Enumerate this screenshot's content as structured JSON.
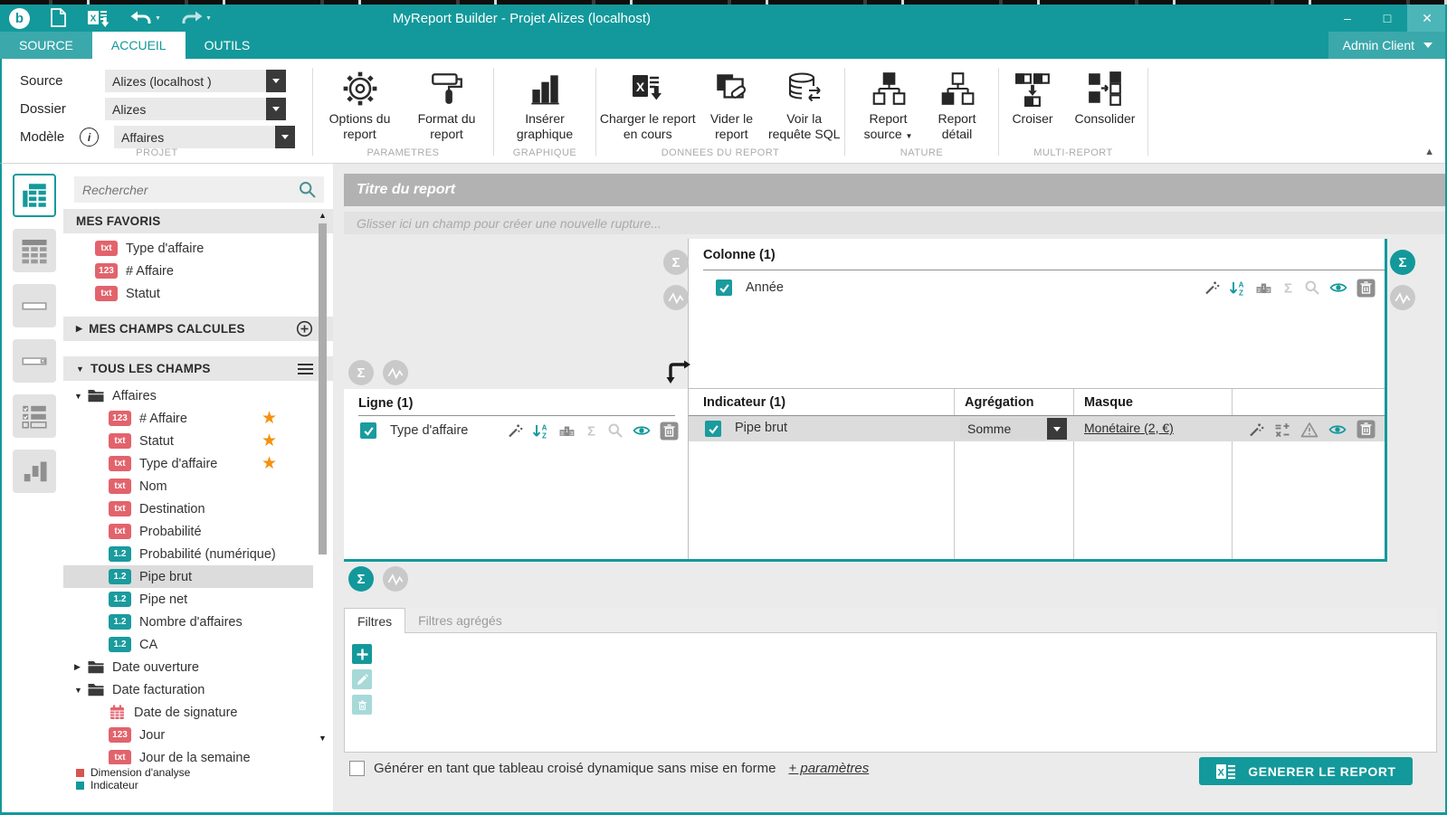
{
  "window": {
    "title": "MyReport Builder - Projet Alizes (localhost)",
    "controls": {
      "minimize": "–",
      "maximize": "□",
      "close": "✕"
    }
  },
  "tabs": [
    {
      "label": "SOURCE",
      "active": false
    },
    {
      "label": "ACCUEIL",
      "active": true
    },
    {
      "label": "OUTILS",
      "active": false
    }
  ],
  "user_menu": {
    "label": "Admin Client"
  },
  "ribbon": {
    "projet": {
      "caption": "PROJET",
      "rows": [
        {
          "label": "Source",
          "value": "Alizes (localhost )"
        },
        {
          "label": "Dossier",
          "value": "Alizes"
        },
        {
          "label": "Modèle",
          "value": "Affaires",
          "info": "i"
        }
      ]
    },
    "parametres": {
      "caption": "PARAMETRES",
      "options_label": "Options du report",
      "format_label": "Format du report"
    },
    "graphique": {
      "caption": "GRAPHIQUE",
      "inserer_label": "Insérer graphique"
    },
    "donnees": {
      "caption": "DONNEES DU REPORT",
      "charger_label": "Charger le report en cours",
      "vider_label": "Vider le report",
      "sql_label": "Voir la requête SQL"
    },
    "nature": {
      "caption": "NATURE",
      "source_label": "Report source",
      "detail_label": "Report détail"
    },
    "multireport": {
      "caption": "MULTI-REPORT",
      "croiser_label": "Croiser",
      "consolider_label": "Consolider"
    }
  },
  "fields_panel": {
    "search_placeholder": "Rechercher",
    "favorites_header": "MES FAVORIS",
    "favorites": [
      {
        "badge": "txt",
        "color": "red",
        "label": "Type d'affaire"
      },
      {
        "badge": "123",
        "color": "red",
        "label": "# Affaire"
      },
      {
        "badge": "txt",
        "color": "red",
        "label": "Statut"
      }
    ],
    "calculated_header": "MES CHAMPS CALCULES",
    "all_fields_header": "TOUS LES CHAMPS",
    "tree": [
      {
        "kind": "folder",
        "state": "open",
        "label": "Affaires"
      },
      {
        "kind": "field",
        "badge": "123",
        "color": "red",
        "label": "# Affaire",
        "starred": true
      },
      {
        "kind": "field",
        "badge": "txt",
        "color": "red",
        "label": "Statut",
        "starred": true
      },
      {
        "kind": "field",
        "badge": "txt",
        "color": "red",
        "label": "Type d'affaire",
        "starred": true
      },
      {
        "kind": "field",
        "badge": "txt",
        "color": "red",
        "label": "Nom"
      },
      {
        "kind": "field",
        "badge": "txt",
        "color": "red",
        "label": "Destination"
      },
      {
        "kind": "field",
        "badge": "txt",
        "color": "red",
        "label": "Probabilité"
      },
      {
        "kind": "field",
        "badge": "1.2",
        "color": "teal",
        "label": "Probabilité (numérique)"
      },
      {
        "kind": "field",
        "badge": "1.2",
        "color": "teal",
        "label": "Pipe brut",
        "selected": true
      },
      {
        "kind": "field",
        "badge": "1.2",
        "color": "teal",
        "label": "Pipe net"
      },
      {
        "kind": "field",
        "badge": "1.2",
        "color": "teal",
        "label": "Nombre d'affaires"
      },
      {
        "kind": "field",
        "badge": "1.2",
        "color": "teal",
        "label": "CA"
      },
      {
        "kind": "folder",
        "state": "closed",
        "label": "Date ouverture"
      },
      {
        "kind": "folder",
        "state": "open",
        "label": "Date facturation"
      },
      {
        "kind": "field",
        "badge": "cal",
        "color": "red",
        "label": "Date de signature"
      },
      {
        "kind": "field",
        "badge": "123",
        "color": "red",
        "label": "Jour"
      },
      {
        "kind": "field",
        "badge": "txt",
        "color": "red",
        "label": "Jour de la semaine",
        "clipped": true
      }
    ],
    "legend": [
      {
        "color": "#D9534F",
        "label": "Dimension d'analyse"
      },
      {
        "color": "#13999B",
        "label": "Indicateur"
      }
    ]
  },
  "report": {
    "title": "Titre du report",
    "rupture_hint": "Glisser ici un champ pour créer une nouvelle rupture...",
    "colonne": {
      "header": "Colonne (1)",
      "row": {
        "label": "Année",
        "checked": true
      }
    },
    "ligne": {
      "header": "Ligne (1)",
      "row": {
        "label": "Type d'affaire",
        "checked": true
      }
    },
    "indicateur": {
      "header": "Indicateur (1)",
      "agg_header": "Agrégation",
      "masque_header": "Masque",
      "row": {
        "label": "Pipe brut",
        "checked": true,
        "aggregation": "Somme",
        "masque": "Monétaire (2, €)"
      }
    }
  },
  "filters": {
    "tabs": [
      {
        "label": "Filtres",
        "active": true
      },
      {
        "label": "Filtres agrégés",
        "active": false
      }
    ]
  },
  "footer": {
    "checkbox_label": "Générer en tant que tableau croisé dynamique sans mise en forme",
    "params_link": "+ paramètres",
    "generate_button": "GENERER LE REPORT"
  },
  "colors": {
    "accent": "#13999B",
    "dimension_badge": "#E2636C",
    "indicator_badge": "#1A9B9E",
    "star": "#F5910D"
  }
}
